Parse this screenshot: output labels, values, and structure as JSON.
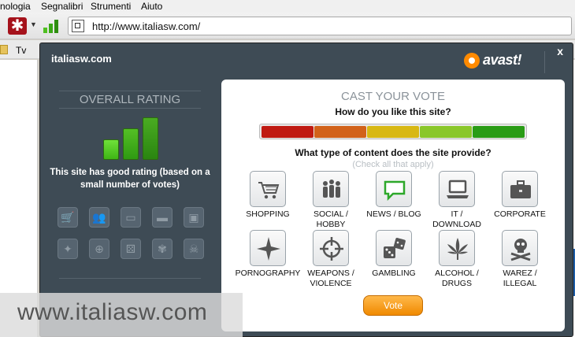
{
  "menu": {
    "items": [
      "nologia",
      "Segnalibri",
      "Strumenti",
      "Aiuto"
    ]
  },
  "toolbar": {
    "url": "http://www.italiasw.com/"
  },
  "bookmarks": {
    "items": [
      "Tv"
    ]
  },
  "overlay": {
    "site": "italiasw.com",
    "close": "x",
    "brand": "avast!",
    "rating": {
      "title": "OVERALL RATING",
      "level": 3,
      "max_level": 3,
      "text": "This site has good rating (based on a small number of votes)",
      "icons": [
        "shopping-cart-icon",
        "people-icon",
        "speech-bubble-icon",
        "laptop-icon",
        "briefcase-icon",
        "star-icon",
        "crosshair-icon",
        "dice-icon",
        "leaf-icon",
        "skull-icon"
      ]
    },
    "vote": {
      "title": "CAST YOUR VOTE",
      "question": "How do you like this site?",
      "scale_colors": [
        "#c01a12",
        "#d2621a",
        "#d8b814",
        "#8ac72a",
        "#2a9c16"
      ],
      "type_question": "What type of content does the site provide?",
      "type_hint": "(Check all that apply)",
      "categories": [
        {
          "label": "SHOPPING",
          "icon": "shopping-cart-icon"
        },
        {
          "label": "SOCIAL / HOBBY",
          "icon": "people-icon"
        },
        {
          "label": "NEWS / BLOG",
          "icon": "speech-bubble-icon"
        },
        {
          "label": "IT / DOWNLOAD",
          "icon": "laptop-icon"
        },
        {
          "label": "CORPORATE",
          "icon": "briefcase-icon"
        },
        {
          "label": "PORNOGRAPHY",
          "icon": "star-icon"
        },
        {
          "label": "WEAPONS / VIOLENCE",
          "icon": "crosshair-icon"
        },
        {
          "label": "GAMBLING",
          "icon": "dice-icon"
        },
        {
          "label": "ALCOHOL / DRUGS",
          "icon": "leaf-icon"
        },
        {
          "label": "WAREZ / ILLEGAL",
          "icon": "skull-icon"
        }
      ],
      "vote_label": "Vote"
    }
  },
  "watermark": "www.italiasw.com"
}
